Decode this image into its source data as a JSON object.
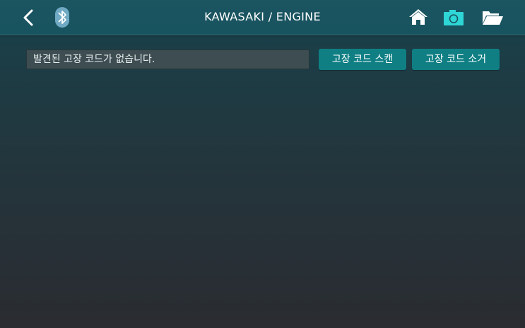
{
  "header": {
    "title": "KAWASAKI / ENGINE",
    "icons": [
      "back-icon",
      "bluetooth-icon",
      "home-icon",
      "camera-icon",
      "folder-icon"
    ]
  },
  "dtc": {
    "message": "발견된 고장 코드가 없습니다.",
    "scan_label": "고장 코드 스캔",
    "clear_label": "고장 코드 소거"
  },
  "colors": {
    "accent": "#0f7f84",
    "header": "#185360",
    "camera": "#2fd6d6"
  }
}
